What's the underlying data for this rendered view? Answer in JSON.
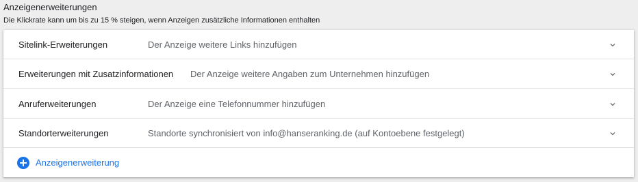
{
  "section": {
    "title": "Anzeigenerweiterungen",
    "subtitle": "Die Klickrate kann um bis zu 15 % steigen, wenn Anzeigen zusätzliche Informationen enthalten"
  },
  "extensions": [
    {
      "label": "Sitelink-Erweiterungen",
      "description": "Der Anzeige weitere Links hinzufügen"
    },
    {
      "label": "Erweiterungen mit Zusatzinformationen",
      "description": "Der Anzeige weitere Angaben zum Unternehmen hinzufügen"
    },
    {
      "label": "Anruferweiterungen",
      "description": "Der Anzeige eine Telefonnummer hinzufügen"
    },
    {
      "label": "Standorterweiterungen",
      "description": "Standorte synchronisiert von info@hanseranking.de (auf Kontoebene festgelegt)"
    }
  ],
  "add_button": {
    "label": "Anzeigenerweiterung",
    "icon": "add-circle-icon"
  },
  "colors": {
    "accent": "#1a73e8",
    "text_primary": "#202124",
    "text_secondary": "#5f6368",
    "background": "#eeeeee",
    "card": "#ffffff"
  }
}
